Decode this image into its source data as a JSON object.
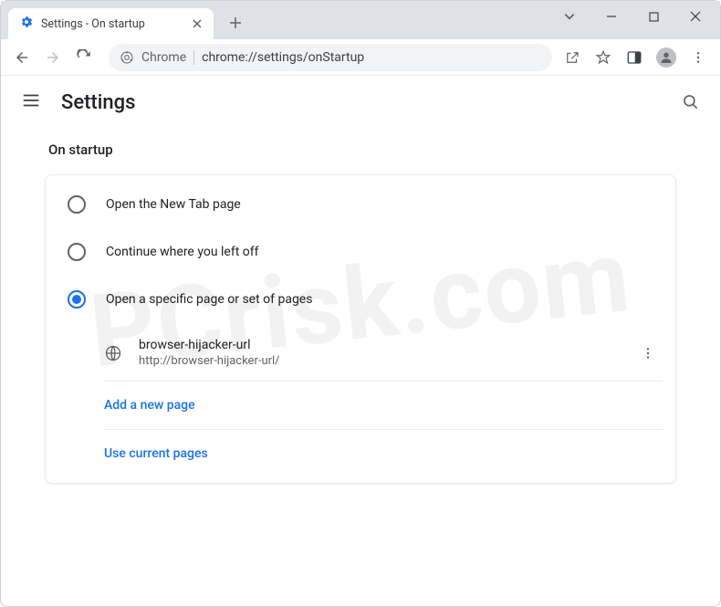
{
  "window": {
    "tab_title": "Settings - On startup",
    "url_prefix": "Chrome",
    "url": "chrome://settings/onStartup"
  },
  "header": {
    "title": "Settings"
  },
  "section": {
    "title": "On startup",
    "options": {
      "new_tab": "Open the New Tab page",
      "continue": "Continue where you left off",
      "specific": "Open a specific page or set of pages"
    },
    "selected": "specific",
    "pages": [
      {
        "name": "browser-hijacker-url",
        "url": "http://browser-hijacker-url/"
      }
    ],
    "add_page": "Add a new page",
    "use_current": "Use current pages"
  },
  "watermark": "PCrisk.com"
}
